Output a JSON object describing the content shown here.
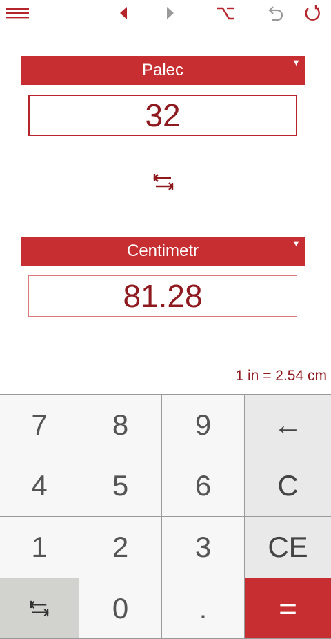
{
  "toolbar": {
    "icons": [
      "menu-icon",
      "prev-icon",
      "next-icon",
      "option-icon",
      "undo-icon",
      "refresh-icon"
    ]
  },
  "from": {
    "unit": "Palec",
    "value": "32"
  },
  "to": {
    "unit": "Centimetr",
    "value": "81.28"
  },
  "ratio_text": "1 in = 2.54 cm",
  "keys": {
    "k7": "7",
    "k8": "8",
    "k9": "9",
    "backspace": "←",
    "k4": "4",
    "k5": "5",
    "k6": "6",
    "clear": "C",
    "k1": "1",
    "k2": "2",
    "k3": "3",
    "clear_entry": "CE",
    "k0": "0",
    "dot": ".",
    "equals": "="
  },
  "colors": {
    "accent": "#c62e32",
    "value_text": "#8e1a20"
  }
}
